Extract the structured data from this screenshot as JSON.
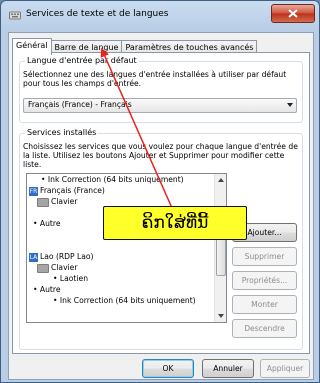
{
  "window": {
    "title": "Services de texte et de langues",
    "close_icon": "close-icon"
  },
  "tabs": [
    {
      "label": "Général",
      "active": true
    },
    {
      "label": "Barre de langue",
      "active": false
    },
    {
      "label": "Paramètres de touches avancés",
      "active": false
    }
  ],
  "default_language": {
    "group_title": "Langue d'entrée par défaut",
    "description": "Sélectionnez une des langues d'entrée installées à utiliser par défaut pour tous les champs d'entrée.",
    "selected": "Français (France) - Français"
  },
  "installed_services": {
    "group_title": "Services installés",
    "description": "Choisissez les services que vous voulez pour chaque langue d'entrée de la liste. Utilisez les boutons Ajouter et Supprimer pour modifier cette liste.",
    "tree": {
      "ink1": "Ink Correction (64 bits uniquement)",
      "fr_badge": "FR",
      "fr_lang": "Français (France)",
      "fr_clavier": "Clavier",
      "fr_autre": "Autre",
      "lao_badge": "LA",
      "lao_lang": "Lao (RDP Lao)",
      "lao_clavier": "Clavier",
      "laotien": "Laotien",
      "lao_autre": "Autre",
      "ink2": "Ink Correction (64 bits uniquement)"
    },
    "buttons": {
      "add": "Ajouter...",
      "remove": "Supprimer",
      "properties": "Propriétés...",
      "up": "Monter",
      "down": "Descendre"
    }
  },
  "footer": {
    "ok": "OK",
    "cancel": "Annuler",
    "apply": "Appliquer"
  },
  "annotation": {
    "callout_text": "ຄິກໃສ່ທີ່ນີ້",
    "arrow_color": "#e8231b",
    "callout_color": "#ffff2a"
  }
}
